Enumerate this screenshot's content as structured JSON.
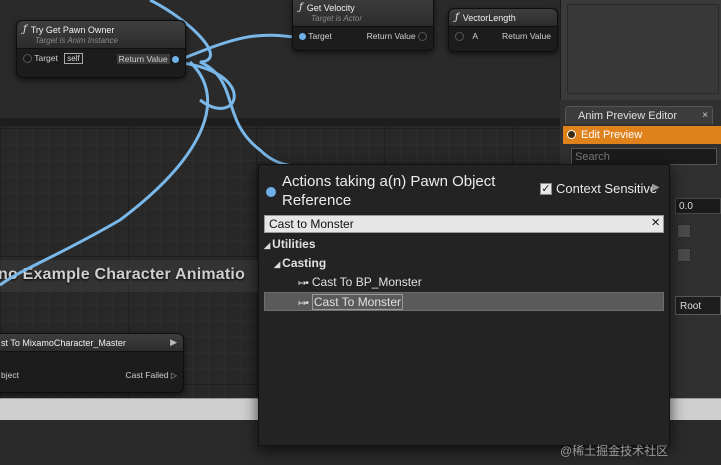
{
  "graph": {
    "comment_text": "no Example Character Animatio"
  },
  "nodes": {
    "try_get_pawn_owner": {
      "title": "Try Get Pawn Owner",
      "subtitle": "Target is Anim Instance",
      "target_label": "Target",
      "target_value": "self",
      "return_label": "Return Value"
    },
    "get_velocity": {
      "title": "Get Velocity",
      "subtitle": "Target is Actor",
      "target_label": "Target",
      "return_label": "Return Value"
    },
    "vector_length": {
      "title": "VectorLength",
      "a_label": "A",
      "return_label": "Return Value"
    },
    "cast_mixamo": {
      "title": "st To MixamoCharacter_Master",
      "object_label": "bject",
      "cast_failed_label": "Cast Failed"
    }
  },
  "panel": {
    "tab_label": "Anim Preview Editor",
    "tab_close": "×",
    "edit_preview": "Edit Preview",
    "search_placeholder": "Search",
    "value_field": "0.0",
    "root_button": "Root"
  },
  "popup": {
    "title": "Actions taking a(n) Pawn Object Reference",
    "context_sensitive_label": "Context Sensitive",
    "context_sensitive_checked": true,
    "search_value": "Cast to Monster",
    "clear_icon": "×",
    "tree": [
      {
        "label": "Utilities",
        "type": "category",
        "level": 0
      },
      {
        "label": "Casting",
        "type": "category",
        "level": 1
      },
      {
        "label": "Cast To BP_Monster",
        "type": "action",
        "level": 2
      },
      {
        "label": "Cast To Monster",
        "type": "action",
        "level": 2,
        "selected": true
      }
    ]
  },
  "watermark": "@稀土掘金技术社区",
  "colors": {
    "pin_blue": "#6fb0e8",
    "accent_orange": "#e0821c",
    "wire_blue": "#7ab8ea"
  }
}
